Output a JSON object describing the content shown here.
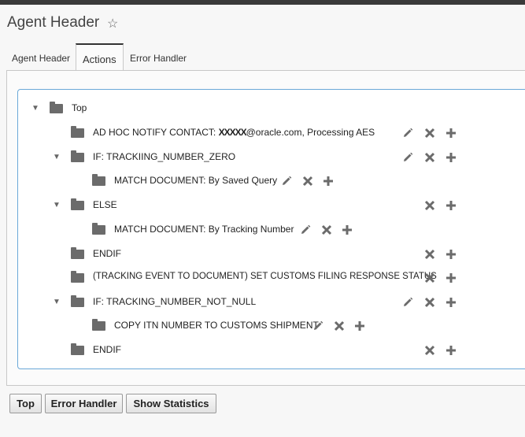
{
  "header": {
    "title": "Agent Header"
  },
  "tabs": [
    {
      "label": "Agent Header",
      "active": false
    },
    {
      "label": "Actions",
      "active": true
    },
    {
      "label": "Error Handler",
      "active": false
    }
  ],
  "tree": {
    "root": {
      "label": "Top",
      "expanded": true
    },
    "nodes": [
      {
        "label": "AD HOC NOTIFY CONTACT: ",
        "redacted": "XXXXX",
        "label_suffix": "@oracle.com, Processing AES",
        "actions": [
          "edit",
          "delete",
          "add"
        ]
      },
      {
        "label": "IF: TRACKIING_NUMBER_ZERO",
        "expanded": true,
        "actions": [
          "edit",
          "delete",
          "add"
        ]
      },
      {
        "label": "MATCH DOCUMENT: By Saved Query",
        "actions": [
          "edit",
          "delete",
          "add"
        ]
      },
      {
        "label": "ELSE",
        "expanded": true,
        "actions": [
          "delete",
          "add"
        ]
      },
      {
        "label": "MATCH DOCUMENT: By Tracking Number",
        "actions": [
          "edit",
          "delete",
          "add"
        ]
      },
      {
        "label": "ENDIF",
        "actions": [
          "delete",
          "add"
        ]
      },
      {
        "label": "(TRACKING EVENT TO DOCUMENT) SET CUSTOMS FILING RESPONSE STATUS",
        "actions": [
          "delete",
          "add"
        ]
      },
      {
        "label": "IF: TRACKING_NUMBER_NOT_NULL",
        "expanded": true,
        "actions": [
          "edit",
          "delete",
          "add"
        ]
      },
      {
        "label": "COPY ITN NUMBER TO CUSTOMS SHIPMENT",
        "actions": [
          "edit",
          "delete",
          "add"
        ]
      },
      {
        "label": "ENDIF",
        "actions": [
          "delete",
          "add"
        ]
      }
    ]
  },
  "buttons": {
    "top": "Top",
    "error_handler": "Error Handler",
    "show_statistics": "Show Statistics"
  },
  "icons": {
    "favorite": "star-outline-icon",
    "folder": "folder-icon",
    "expand": "triangle-down-icon",
    "edit": "pencil-icon",
    "delete": "x-icon",
    "add": "plus-icon"
  },
  "colors": {
    "icon_gray": "#6b6b6b",
    "tree_border": "#6aa8d8",
    "active_tab_top": "#333333"
  }
}
